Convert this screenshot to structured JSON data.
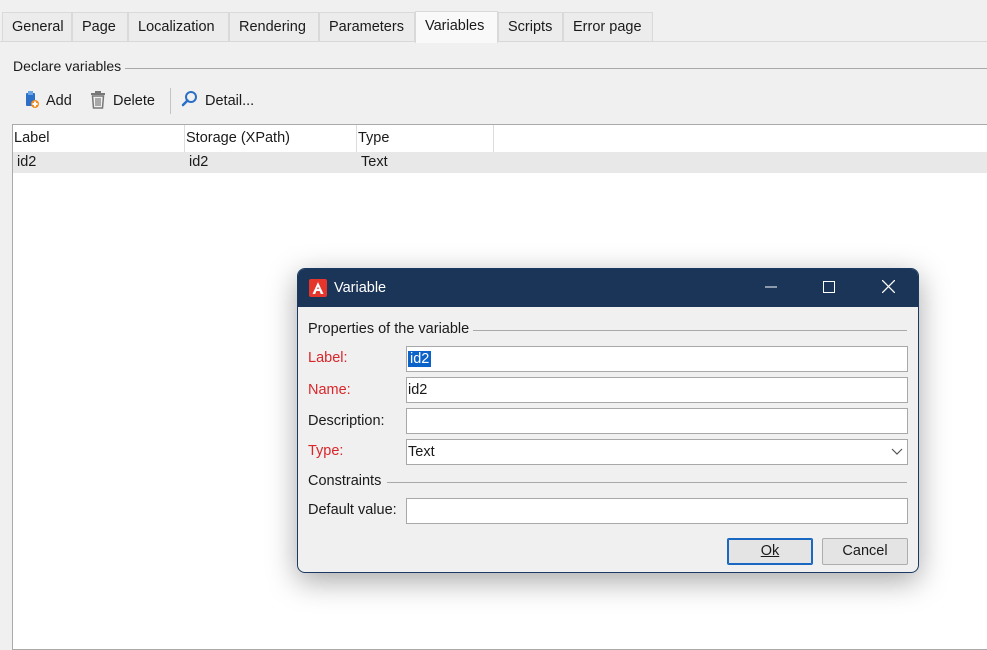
{
  "tabs": [
    {
      "label": "General"
    },
    {
      "label": "Page"
    },
    {
      "label": "Localization"
    },
    {
      "label": "Rendering"
    },
    {
      "label": "Parameters"
    },
    {
      "label": "Variables",
      "active": true
    },
    {
      "label": "Scripts"
    },
    {
      "label": "Error page"
    }
  ],
  "section": {
    "title": "Declare variables"
  },
  "toolbar": {
    "add_label": "Add",
    "delete_label": "Delete",
    "detail_label": "Detail..."
  },
  "list": {
    "columns": [
      "Label",
      "Storage (XPath)",
      "Type"
    ],
    "rows": [
      {
        "label": "id2",
        "storage": "id2",
        "type": "Text"
      }
    ]
  },
  "dialog": {
    "title": "Variable",
    "properties_title": "Properties of the variable",
    "label_label": "Label:",
    "label_value": "id2",
    "name_label": "Name:",
    "name_value": "id2",
    "description_label": "Description:",
    "description_value": "",
    "type_label": "Type:",
    "type_value": "Text",
    "constraints_title": "Constraints",
    "default_label": "Default value:",
    "default_value": "",
    "ok_label": "Ok",
    "cancel_label": "Cancel"
  },
  "colors": {
    "titlebar": "#1b3558",
    "required_label": "#d9262a",
    "selection": "#0b63c9",
    "app_icon": "#e6352b"
  },
  "icons": [
    "add-icon",
    "delete-icon",
    "detail-icon",
    "app-icon",
    "minimize-icon",
    "maximize-icon",
    "close-icon",
    "chevron-down-icon"
  ]
}
